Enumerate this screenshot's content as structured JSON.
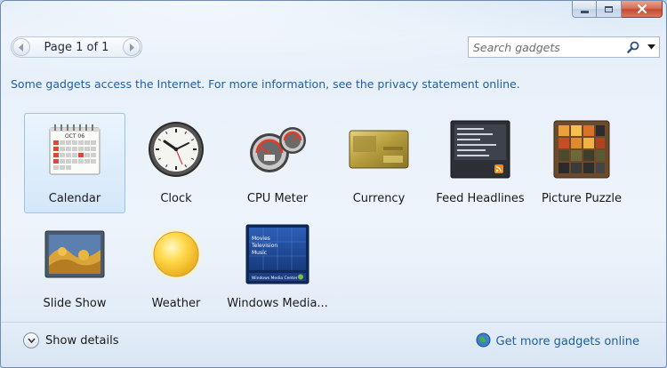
{
  "window": {
    "controls": {
      "minimize": "minimize",
      "maximize": "maximize",
      "close": "close"
    }
  },
  "header": {
    "page_label": "Page 1 of 1",
    "search_placeholder": "Search gadgets"
  },
  "notice": "Some gadgets access the Internet.  For more information, see the privacy statement online.",
  "gadgets": [
    {
      "label": "Calendar",
      "icon": "calendar-icon",
      "selected": true
    },
    {
      "label": "Clock",
      "icon": "clock-icon"
    },
    {
      "label": "CPU Meter",
      "icon": "cpu-meter-icon"
    },
    {
      "label": "Currency",
      "icon": "currency-icon"
    },
    {
      "label": "Feed Headlines",
      "icon": "feed-headlines-icon"
    },
    {
      "label": "Picture Puzzle",
      "icon": "picture-puzzle-icon"
    },
    {
      "label": "Slide Show",
      "icon": "slide-show-icon"
    },
    {
      "label": "Weather",
      "icon": "weather-icon"
    },
    {
      "label": "Windows Media...",
      "icon": "windows-media-center-icon"
    }
  ],
  "thumb_text": {
    "calendar_month": "OCT 06",
    "media_items": [
      "Movies",
      "Television",
      "Music"
    ],
    "media_bar": "Windows Media Center"
  },
  "footer": {
    "show_details": "Show details",
    "get_more": "Get more gadgets online"
  },
  "colors": {
    "link": "#1f5e9f",
    "selection_border": "#99c4ee",
    "close_button": "#c74a2e"
  }
}
